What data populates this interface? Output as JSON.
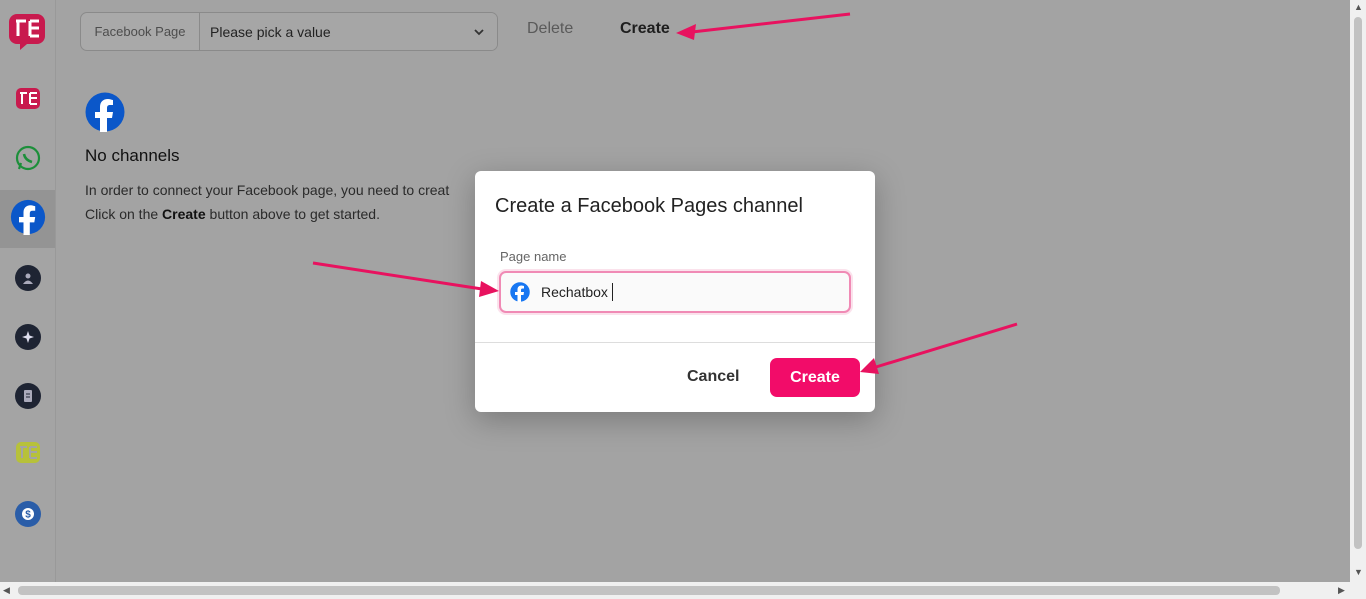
{
  "topbar": {
    "select_label": "Facebook Page",
    "select_value": "Please pick a value",
    "delete_label": "Delete",
    "create_label": "Create"
  },
  "sidebar": {
    "items": [
      {
        "icon": "rechatbox-logo-icon"
      },
      {
        "icon": "rechatbox-icon"
      },
      {
        "icon": "whatsapp-icon"
      },
      {
        "icon": "facebook-icon"
      },
      {
        "icon": "contact-icon"
      },
      {
        "icon": "sparkle-icon"
      },
      {
        "icon": "document-icon"
      },
      {
        "icon": "rechatbox-alt-icon"
      },
      {
        "icon": "billing-icon"
      }
    ]
  },
  "empty_state": {
    "title": "No channels",
    "line1": "In order to connect your Facebook page, you need to creat",
    "line2_prefix": "Click on the ",
    "line2_bold": "Create",
    "line2_suffix": " button above to get started."
  },
  "modal": {
    "title": "Create a Facebook Pages channel",
    "field_label": "Page name",
    "field_value": "Rechatbox",
    "cancel_label": "Cancel",
    "create_label": "Create"
  },
  "colors": {
    "accent": "#f20c69",
    "facebook": "#1877f2",
    "arrow": "#e8125f",
    "overlay": "#a3a3a3"
  }
}
